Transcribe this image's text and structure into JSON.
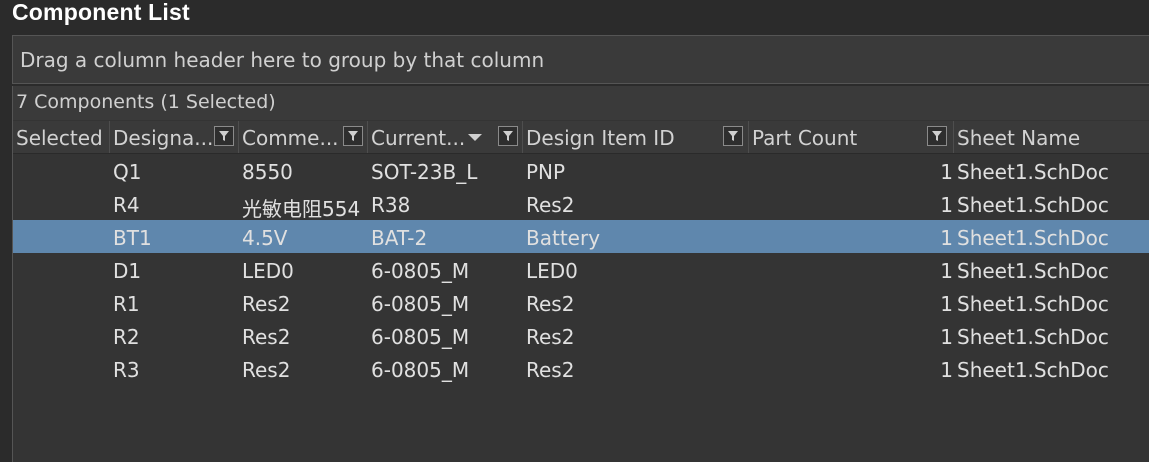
{
  "panel": {
    "title": "Component List",
    "group_hint": "Drag a column header here to group by that column",
    "count_text": "7 Components (1 Selected)"
  },
  "columns": [
    {
      "label": "Selected",
      "filter": false
    },
    {
      "label": "Designa...",
      "filter": true
    },
    {
      "label": "Comme...",
      "filter": true
    },
    {
      "label": "Current...",
      "filter": true,
      "sorted": "descending"
    },
    {
      "label": "Design Item ID",
      "filter": true
    },
    {
      "label": "Part Count",
      "filter": true
    },
    {
      "label": "Sheet Name",
      "filter": false
    }
  ],
  "rows": [
    {
      "designator": "Q1",
      "comment": "8550",
      "footprint": "SOT-23B_L",
      "design_item_id": "PNP",
      "part_count": "1",
      "sheet": "Sheet1.SchDoc",
      "selected": false
    },
    {
      "designator": "R4",
      "comment": "光敏电阻554",
      "footprint": "R38",
      "design_item_id": "Res2",
      "part_count": "1",
      "sheet": "Sheet1.SchDoc",
      "selected": false
    },
    {
      "designator": "BT1",
      "comment": "4.5V",
      "footprint": "BAT-2",
      "design_item_id": "Battery",
      "part_count": "1",
      "sheet": "Sheet1.SchDoc",
      "selected": true
    },
    {
      "designator": "D1",
      "comment": "LED0",
      "footprint": "6-0805_M",
      "design_item_id": "LED0",
      "part_count": "1",
      "sheet": "Sheet1.SchDoc",
      "selected": false
    },
    {
      "designator": "R1",
      "comment": "Res2",
      "footprint": "6-0805_M",
      "design_item_id": "Res2",
      "part_count": "1",
      "sheet": "Sheet1.SchDoc",
      "selected": false
    },
    {
      "designator": "R2",
      "comment": "Res2",
      "footprint": "6-0805_M",
      "design_item_id": "Res2",
      "part_count": "1",
      "sheet": "Sheet1.SchDoc",
      "selected": false
    },
    {
      "designator": "R3",
      "comment": "Res2",
      "footprint": "6-0805_M",
      "design_item_id": "Res2",
      "part_count": "1",
      "sheet": "Sheet1.SchDoc",
      "selected": false
    }
  ],
  "colors": {
    "background": "#2b2b2b",
    "selected_row": "#5f87ad",
    "header": "#3a3a3a",
    "text": "#e0e0e0"
  },
  "icons": {
    "filter": "filter-icon",
    "sort": "sort-descending-icon"
  }
}
